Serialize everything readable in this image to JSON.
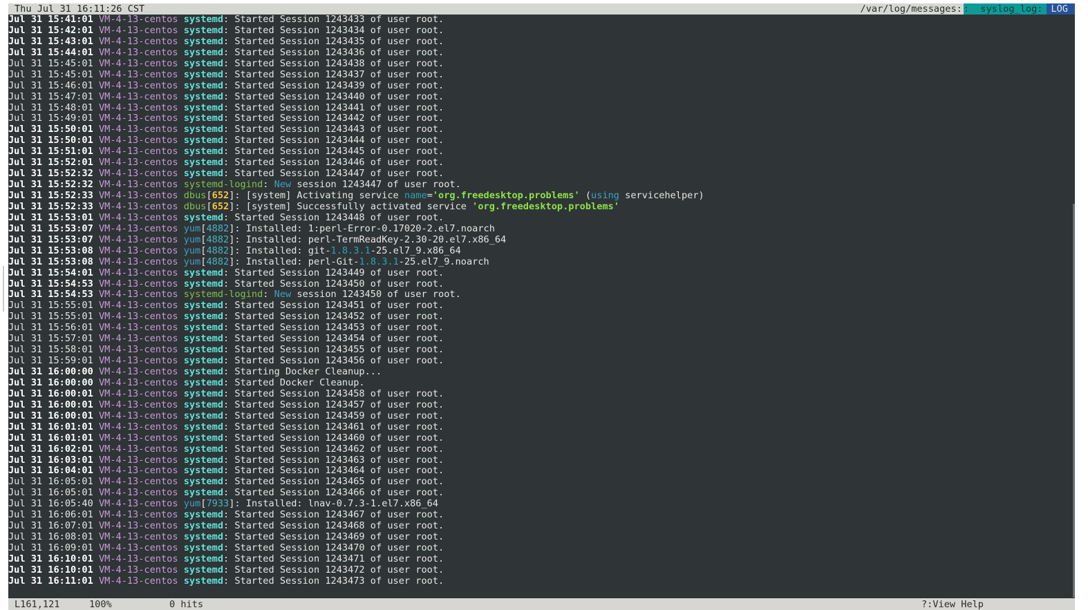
{
  "topbar": {
    "clock": "Thu Jul 31 16:11:26 CST",
    "file": "/var/log/messages:",
    "view": ":  syslog_log:",
    "mode": "LOG"
  },
  "statusbar": {
    "position": "L161,121",
    "percent": "100%",
    "hits": "0 hits",
    "help": "?:View Help"
  },
  "log_lines": [
    {
      "ts": "Jul 31 15:41:01",
      "bold": true,
      "host": "VM-4-13-centos",
      "proc": "systemd",
      "style": "bold",
      "msg": ": Started Session 1243433 of user root."
    },
    {
      "ts": "Jul 31 15:42:01",
      "bold": true,
      "host": "VM-4-13-centos",
      "proc": "systemd",
      "style": "bold",
      "msg": ": Started Session 1243434 of user root."
    },
    {
      "ts": "Jul 31 15:43:01",
      "bold": true,
      "host": "VM-4-13-centos",
      "proc": "systemd",
      "style": "bold",
      "msg": ": Started Session 1243435 of user root."
    },
    {
      "ts": "Jul 31 15:44:01",
      "bold": true,
      "host": "VM-4-13-centos",
      "proc": "systemd",
      "style": "bold",
      "msg": ": Started Session 1243436 of user root."
    },
    {
      "ts": "Jul 31 15:45:01",
      "bold": false,
      "host": "VM-4-13-centos",
      "proc": "systemd",
      "style": "bold",
      "msg": ": Started Session 1243438 of user root."
    },
    {
      "ts": "Jul 31 15:45:01",
      "bold": false,
      "host": "VM-4-13-centos",
      "proc": "systemd",
      "style": "bold",
      "msg": ": Started Session 1243437 of user root."
    },
    {
      "ts": "Jul 31 15:46:01",
      "bold": false,
      "host": "VM-4-13-centos",
      "proc": "systemd",
      "style": "bold",
      "msg": ": Started Session 1243439 of user root."
    },
    {
      "ts": "Jul 31 15:47:01",
      "bold": false,
      "host": "VM-4-13-centos",
      "proc": "systemd",
      "style": "bold",
      "msg": ": Started Session 1243440 of user root."
    },
    {
      "ts": "Jul 31 15:48:01",
      "bold": false,
      "host": "VM-4-13-centos",
      "proc": "systemd",
      "style": "bold",
      "msg": ": Started Session 1243441 of user root."
    },
    {
      "ts": "Jul 31 15:49:01",
      "bold": false,
      "host": "VM-4-13-centos",
      "proc": "systemd",
      "style": "bold",
      "msg": ": Started Session 1243442 of user root."
    },
    {
      "ts": "Jul 31 15:50:01",
      "bold": true,
      "host": "VM-4-13-centos",
      "proc": "systemd",
      "style": "bold",
      "msg": ": Started Session 1243443 of user root."
    },
    {
      "ts": "Jul 31 15:50:01",
      "bold": true,
      "host": "VM-4-13-centos",
      "proc": "systemd",
      "style": "bold",
      "msg": ": Started Session 1243444 of user root."
    },
    {
      "ts": "Jul 31 15:51:01",
      "bold": true,
      "host": "VM-4-13-centos",
      "proc": "systemd",
      "style": "bold",
      "msg": ": Started Session 1243445 of user root."
    },
    {
      "ts": "Jul 31 15:52:01",
      "bold": true,
      "host": "VM-4-13-centos",
      "proc": "systemd",
      "style": "bold",
      "msg": ": Started Session 1243446 of user root."
    },
    {
      "ts": "Jul 31 15:52:32",
      "bold": true,
      "host": "VM-4-13-centos",
      "proc": "systemd",
      "style": "bold",
      "msg": ": Started Session 1243447 of user root."
    },
    {
      "ts": "Jul 31 15:52:32",
      "bold": true,
      "host": "VM-4-13-centos",
      "proc": "systemd-logind",
      "style": "green",
      "kind": "logind",
      "kw": "New",
      "msg": " session 1243447 of user root."
    },
    {
      "ts": "Jul 31 15:52:33",
      "bold": true,
      "host": "VM-4-13-centos",
      "proc": "dbus",
      "style": "green",
      "pid": "652",
      "pidstyle": "bold",
      "kind": "dbus1",
      "pre": ": [system] Activating service ",
      "k1": "name",
      "eq": "=",
      "str": "'org.freedesktop.problems'",
      "mid": " (",
      "k2": "using",
      "post": " servicehelper)"
    },
    {
      "ts": "Jul 31 15:52:33",
      "bold": true,
      "host": "VM-4-13-centos",
      "proc": "dbus",
      "style": "green",
      "pid": "652",
      "pidstyle": "bold",
      "kind": "dbus2",
      "pre": ": [system] Successfully activated service ",
      "str": "'org.freedesktop.problems'"
    },
    {
      "ts": "Jul 31 15:53:01",
      "bold": true,
      "host": "VM-4-13-centos",
      "proc": "systemd",
      "style": "bold",
      "msg": ": Started Session 1243448 of user root."
    },
    {
      "ts": "Jul 31 15:53:07",
      "bold": true,
      "host": "VM-4-13-centos",
      "proc": "yum",
      "style": "blue",
      "pid": "4882",
      "pidstyle": "plain",
      "msg": ": Installed: 1:perl-Error-0.17020-2.el7.noarch"
    },
    {
      "ts": "Jul 31 15:53:07",
      "bold": true,
      "host": "VM-4-13-centos",
      "proc": "yum",
      "style": "blue",
      "pid": "4882",
      "pidstyle": "plain",
      "msg": ": Installed: perl-TermReadKey-2.30-20.el7.x86_64"
    },
    {
      "ts": "Jul 31 15:53:08",
      "bold": true,
      "host": "VM-4-13-centos",
      "proc": "yum",
      "style": "blue",
      "pid": "4882",
      "pidstyle": "plain",
      "kind": "ver",
      "pre": ": Installed: git-",
      "ver": "1.8.3.1",
      "post": "-25.el7_9.x86_64"
    },
    {
      "ts": "Jul 31 15:53:08",
      "bold": true,
      "host": "VM-4-13-centos",
      "proc": "yum",
      "style": "blue",
      "pid": "4882",
      "pidstyle": "plain",
      "kind": "ver",
      "pre": ": Installed: perl-Git-",
      "ver": "1.8.3.1",
      "post": "-25.el7_9.noarch"
    },
    {
      "ts": "Jul 31 15:54:01",
      "bold": true,
      "host": "VM-4-13-centos",
      "proc": "systemd",
      "style": "bold",
      "msg": ": Started Session 1243449 of user root."
    },
    {
      "ts": "Jul 31 15:54:53",
      "bold": true,
      "host": "VM-4-13-centos",
      "proc": "systemd",
      "style": "bold",
      "msg": ": Started Session 1243450 of user root."
    },
    {
      "ts": "Jul 31 15:54:53",
      "bold": true,
      "host": "VM-4-13-centos",
      "proc": "systemd-logind",
      "style": "green",
      "kind": "logind",
      "kw": "New",
      "msg": " session 1243450 of user root."
    },
    {
      "ts": "Jul 31 15:55:01",
      "bold": false,
      "host": "VM-4-13-centos",
      "proc": "systemd",
      "style": "bold",
      "msg": ": Started Session 1243451 of user root."
    },
    {
      "ts": "Jul 31 15:55:01",
      "bold": false,
      "host": "VM-4-13-centos",
      "proc": "systemd",
      "style": "bold",
      "msg": ": Started Session 1243452 of user root."
    },
    {
      "ts": "Jul 31 15:56:01",
      "bold": false,
      "host": "VM-4-13-centos",
      "proc": "systemd",
      "style": "bold",
      "msg": ": Started Session 1243453 of user root."
    },
    {
      "ts": "Jul 31 15:57:01",
      "bold": false,
      "host": "VM-4-13-centos",
      "proc": "systemd",
      "style": "bold",
      "msg": ": Started Session 1243454 of user root."
    },
    {
      "ts": "Jul 31 15:58:01",
      "bold": false,
      "host": "VM-4-13-centos",
      "proc": "systemd",
      "style": "bold",
      "msg": ": Started Session 1243455 of user root."
    },
    {
      "ts": "Jul 31 15:59:01",
      "bold": false,
      "host": "VM-4-13-centos",
      "proc": "systemd",
      "style": "bold",
      "msg": ": Started Session 1243456 of user root."
    },
    {
      "ts": "Jul 31 16:00:00",
      "bold": true,
      "host": "VM-4-13-centos",
      "proc": "systemd",
      "style": "bold",
      "msg": ": Starting Docker Cleanup..."
    },
    {
      "ts": "Jul 31 16:00:00",
      "bold": true,
      "host": "VM-4-13-centos",
      "proc": "systemd",
      "style": "bold",
      "msg": ": Started Docker Cleanup."
    },
    {
      "ts": "Jul 31 16:00:01",
      "bold": true,
      "host": "VM-4-13-centos",
      "proc": "systemd",
      "style": "bold",
      "msg": ": Started Session 1243458 of user root."
    },
    {
      "ts": "Jul 31 16:00:01",
      "bold": true,
      "host": "VM-4-13-centos",
      "proc": "systemd",
      "style": "bold",
      "msg": ": Started Session 1243457 of user root."
    },
    {
      "ts": "Jul 31 16:00:01",
      "bold": true,
      "host": "VM-4-13-centos",
      "proc": "systemd",
      "style": "bold",
      "msg": ": Started Session 1243459 of user root."
    },
    {
      "ts": "Jul 31 16:01:01",
      "bold": true,
      "host": "VM-4-13-centos",
      "proc": "systemd",
      "style": "bold",
      "msg": ": Started Session 1243461 of user root."
    },
    {
      "ts": "Jul 31 16:01:01",
      "bold": true,
      "host": "VM-4-13-centos",
      "proc": "systemd",
      "style": "bold",
      "msg": ": Started Session 1243460 of user root."
    },
    {
      "ts": "Jul 31 16:02:01",
      "bold": true,
      "host": "VM-4-13-centos",
      "proc": "systemd",
      "style": "bold",
      "msg": ": Started Session 1243462 of user root."
    },
    {
      "ts": "Jul 31 16:03:01",
      "bold": true,
      "host": "VM-4-13-centos",
      "proc": "systemd",
      "style": "bold",
      "msg": ": Started Session 1243463 of user root."
    },
    {
      "ts": "Jul 31 16:04:01",
      "bold": true,
      "host": "VM-4-13-centos",
      "proc": "systemd",
      "style": "bold",
      "msg": ": Started Session 1243464 of user root."
    },
    {
      "ts": "Jul 31 16:05:01",
      "bold": false,
      "host": "VM-4-13-centos",
      "proc": "systemd",
      "style": "bold",
      "msg": ": Started Session 1243465 of user root."
    },
    {
      "ts": "Jul 31 16:05:01",
      "bold": false,
      "host": "VM-4-13-centos",
      "proc": "systemd",
      "style": "bold",
      "msg": ": Started Session 1243466 of user root."
    },
    {
      "ts": "Jul 31 16:05:40",
      "bold": false,
      "host": "VM-4-13-centos",
      "proc": "yum",
      "style": "blue",
      "pid": "7933",
      "pidstyle": "plain",
      "msg": ": Installed: lnav-0.7.3-1.el7.x86_64"
    },
    {
      "ts": "Jul 31 16:06:01",
      "bold": false,
      "host": "VM-4-13-centos",
      "proc": "systemd",
      "style": "bold",
      "msg": ": Started Session 1243467 of user root."
    },
    {
      "ts": "Jul 31 16:07:01",
      "bold": false,
      "host": "VM-4-13-centos",
      "proc": "systemd",
      "style": "bold",
      "msg": ": Started Session 1243468 of user root."
    },
    {
      "ts": "Jul 31 16:08:01",
      "bold": false,
      "host": "VM-4-13-centos",
      "proc": "systemd",
      "style": "bold",
      "msg": ": Started Session 1243469 of user root."
    },
    {
      "ts": "Jul 31 16:09:01",
      "bold": false,
      "host": "VM-4-13-centos",
      "proc": "systemd",
      "style": "bold",
      "msg": ": Started Session 1243470 of user root."
    },
    {
      "ts": "Jul 31 16:10:01",
      "bold": true,
      "host": "VM-4-13-centos",
      "proc": "systemd",
      "style": "bold",
      "msg": ": Started Session 1243471 of user root."
    },
    {
      "ts": "Jul 31 16:10:01",
      "bold": true,
      "host": "VM-4-13-centos",
      "proc": "systemd",
      "style": "bold",
      "msg": ": Started Session 1243472 of user root."
    },
    {
      "ts": "Jul 31 16:11:01",
      "bold": true,
      "host": "VM-4-13-centos",
      "proc": "systemd",
      "style": "bold",
      "msg": ": Started Session 1243473 of user root."
    }
  ]
}
